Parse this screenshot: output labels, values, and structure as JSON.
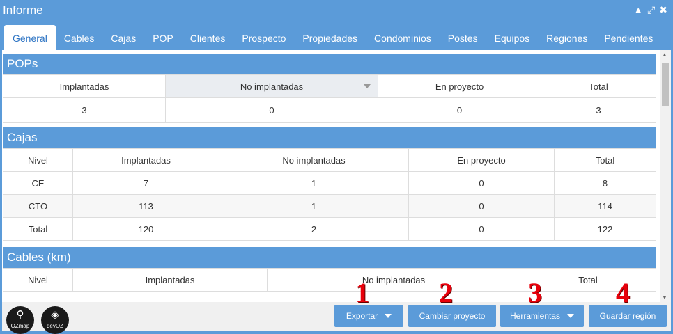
{
  "window": {
    "title": "Informe"
  },
  "tabs": [
    "General",
    "Cables",
    "Cajas",
    "POP",
    "Clientes",
    "Prospecto",
    "Propiedades",
    "Condominios",
    "Postes",
    "Equipos",
    "Regiones",
    "Pendientes"
  ],
  "pops": {
    "title": "POPs",
    "headers": [
      "Implantadas",
      "No implantadas",
      "En proyecto",
      "Total"
    ],
    "row": [
      "3",
      "0",
      "0",
      "3"
    ]
  },
  "cajas": {
    "title": "Cajas",
    "headers": [
      "Nivel",
      "Implantadas",
      "No implantadas",
      "En proyecto",
      "Total"
    ],
    "rows": [
      [
        "CE",
        "7",
        "1",
        "0",
        "8"
      ],
      [
        "CTO",
        "113",
        "1",
        "0",
        "114"
      ],
      [
        "Total",
        "120",
        "2",
        "0",
        "122"
      ]
    ]
  },
  "cables": {
    "title": "Cables (km)",
    "headers": [
      "Nivel",
      "Implantadas",
      "No implantadas",
      "Total"
    ]
  },
  "footer": {
    "logo1": "OZmap",
    "logo2": "devOZ",
    "buttons": {
      "exportar": "Exportar",
      "cambiar": "Cambiar proyecto",
      "herramientas": "Herramientas",
      "guardar": "Guardar región"
    },
    "markers": [
      "1",
      "2",
      "3",
      "4"
    ]
  }
}
